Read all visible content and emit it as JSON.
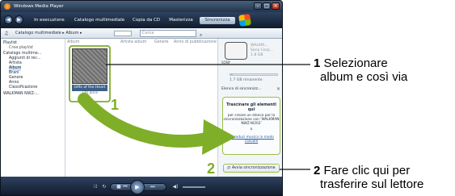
{
  "window": {
    "title": "Windows Media Player"
  },
  "tabs": [
    "In esecuzione",
    "Catalogo multimediale",
    "Copia da CD",
    "Masterizza",
    "Sincronizza"
  ],
  "address_bar": {
    "breadcrumb": "Catalogo multimediale ▸ Album ▸",
    "search_placeholder": "Cerca"
  },
  "nav_tree": [
    "Playlist",
    "Crea playlist",
    "Catalogo multime...",
    "Aggiunti di rec...",
    "Artista",
    "Album",
    "Brani",
    "Genere",
    "Anno",
    "Classificazione",
    "WALKMAN NWZ-..."
  ],
  "columns": [
    "Album",
    "Artista album",
    "Genere",
    "Anno di pubblicazione"
  ],
  "album": {
    "title": "Gifts of the Heart",
    "artist": "Tim Janis"
  },
  "device": {
    "name_line1": "WALKM...",
    "name_line2": "Sony Corp...",
    "name_line3": "1.8 GB",
    "image_label": "SONY",
    "remaining": "1.7 GB rimanente",
    "capacity_used_fraction": 0.06
  },
  "sync_list": {
    "header": "Elenco di sincronizz...",
    "drop_title": "Trascinare gli elementi qui",
    "drop_sub": "per creare un elenco per la sincronizzazione con 'WALKMAN NWZ-W202'",
    "drop_or": "o",
    "drop_link": "Riproduci musica in modo casuale",
    "sync_button": "Avvia sincronizzazione"
  },
  "steps": [
    {
      "number": "1",
      "line1": "Selezionare",
      "line2": "album e così via"
    },
    {
      "number": "2",
      "line1": "Fare clic qui per",
      "line2": "trasferire sul lettore"
    }
  ],
  "colors": {
    "accent_green": "#7fae28",
    "callout_line": "#111111"
  }
}
